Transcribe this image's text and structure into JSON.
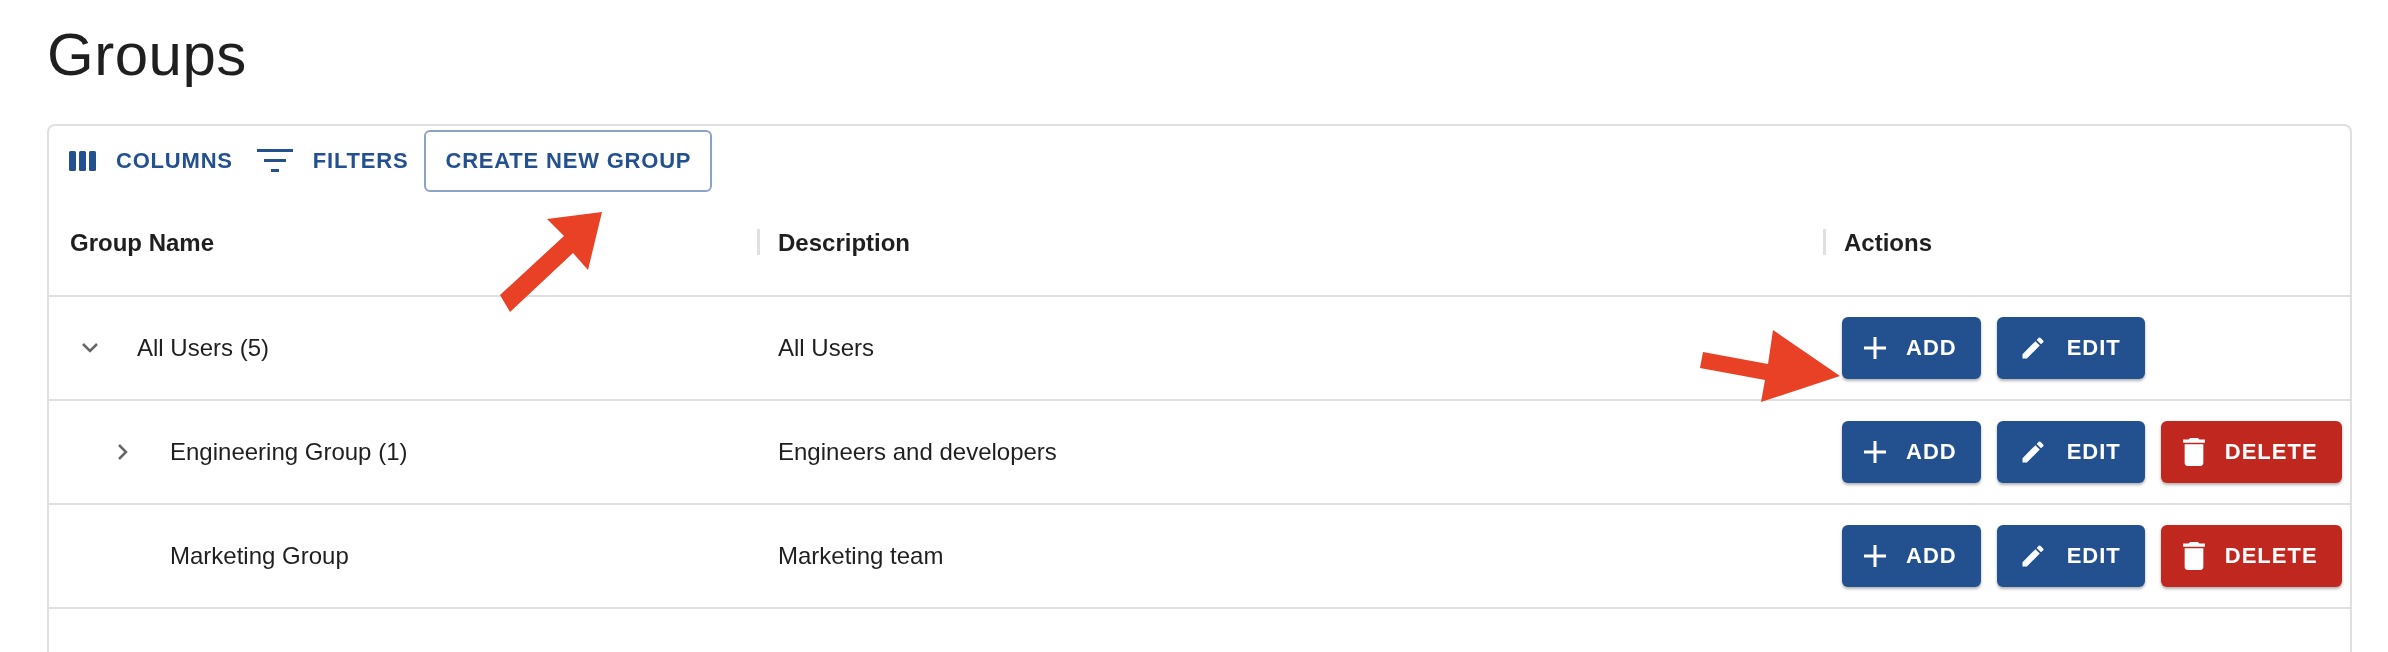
{
  "page_title": "Groups",
  "toolbar": [
    {
      "kind": "columns",
      "label": "COLUMNS"
    },
    {
      "kind": "filters",
      "label": "FILTERS"
    },
    {
      "kind": "create",
      "label": "CREATE NEW GROUP"
    }
  ],
  "table": {
    "columns": [
      "Group Name",
      "Description",
      "Actions"
    ],
    "rows": [
      {
        "name": "All Users (5)",
        "description": "All Users",
        "expanded": true,
        "actions": [
          {
            "kind": "add",
            "label": "ADD"
          },
          {
            "kind": "edit",
            "label": "EDIT"
          }
        ],
        "children": [
          {
            "name": "Engineering Group (1)",
            "description": "Engineers and developers",
            "expanded": false,
            "actions": [
              {
                "kind": "add",
                "label": "ADD"
              },
              {
                "kind": "edit",
                "label": "EDIT"
              },
              {
                "kind": "delete",
                "label": "DELETE"
              }
            ]
          },
          {
            "name": "Marketing Group",
            "description": "Marketing team",
            "actions": [
              {
                "kind": "add",
                "label": "ADD"
              },
              {
                "kind": "edit",
                "label": "EDIT"
              },
              {
                "kind": "delete",
                "label": "DELETE"
              }
            ]
          }
        ]
      }
    ]
  }
}
